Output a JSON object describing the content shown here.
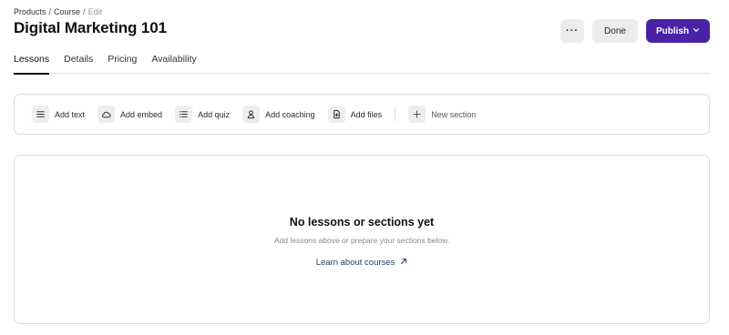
{
  "breadcrumb": {
    "items": [
      "Products",
      "Course",
      "Edit"
    ],
    "separator": "/"
  },
  "page": {
    "title": "Digital Marketing 101"
  },
  "actions": {
    "more_label": "···",
    "done_label": "Done",
    "publish_label": "Publish",
    "publish_color": "#4b22a6"
  },
  "tabs": [
    {
      "label": "Lessons",
      "active": true
    },
    {
      "label": "Details",
      "active": false
    },
    {
      "label": "Pricing",
      "active": false
    },
    {
      "label": "Availability",
      "active": false
    }
  ],
  "toolbar": {
    "items": [
      {
        "label": "Add text",
        "icon": "text-lines-icon"
      },
      {
        "label": "Add embed",
        "icon": "cloud-icon"
      },
      {
        "label": "Add quiz",
        "icon": "list-icon"
      },
      {
        "label": "Add coaching",
        "icon": "person-icon"
      },
      {
        "label": "Add files",
        "icon": "file-plus-icon"
      }
    ],
    "new_section": {
      "label": "New section",
      "icon": "plus-icon"
    }
  },
  "empty_state": {
    "title": "No lessons or sections yet",
    "subtitle": "Add lessons above or prepare your sections below.",
    "link_label": "Learn about courses",
    "link_icon": "arrow-up-right-icon"
  }
}
